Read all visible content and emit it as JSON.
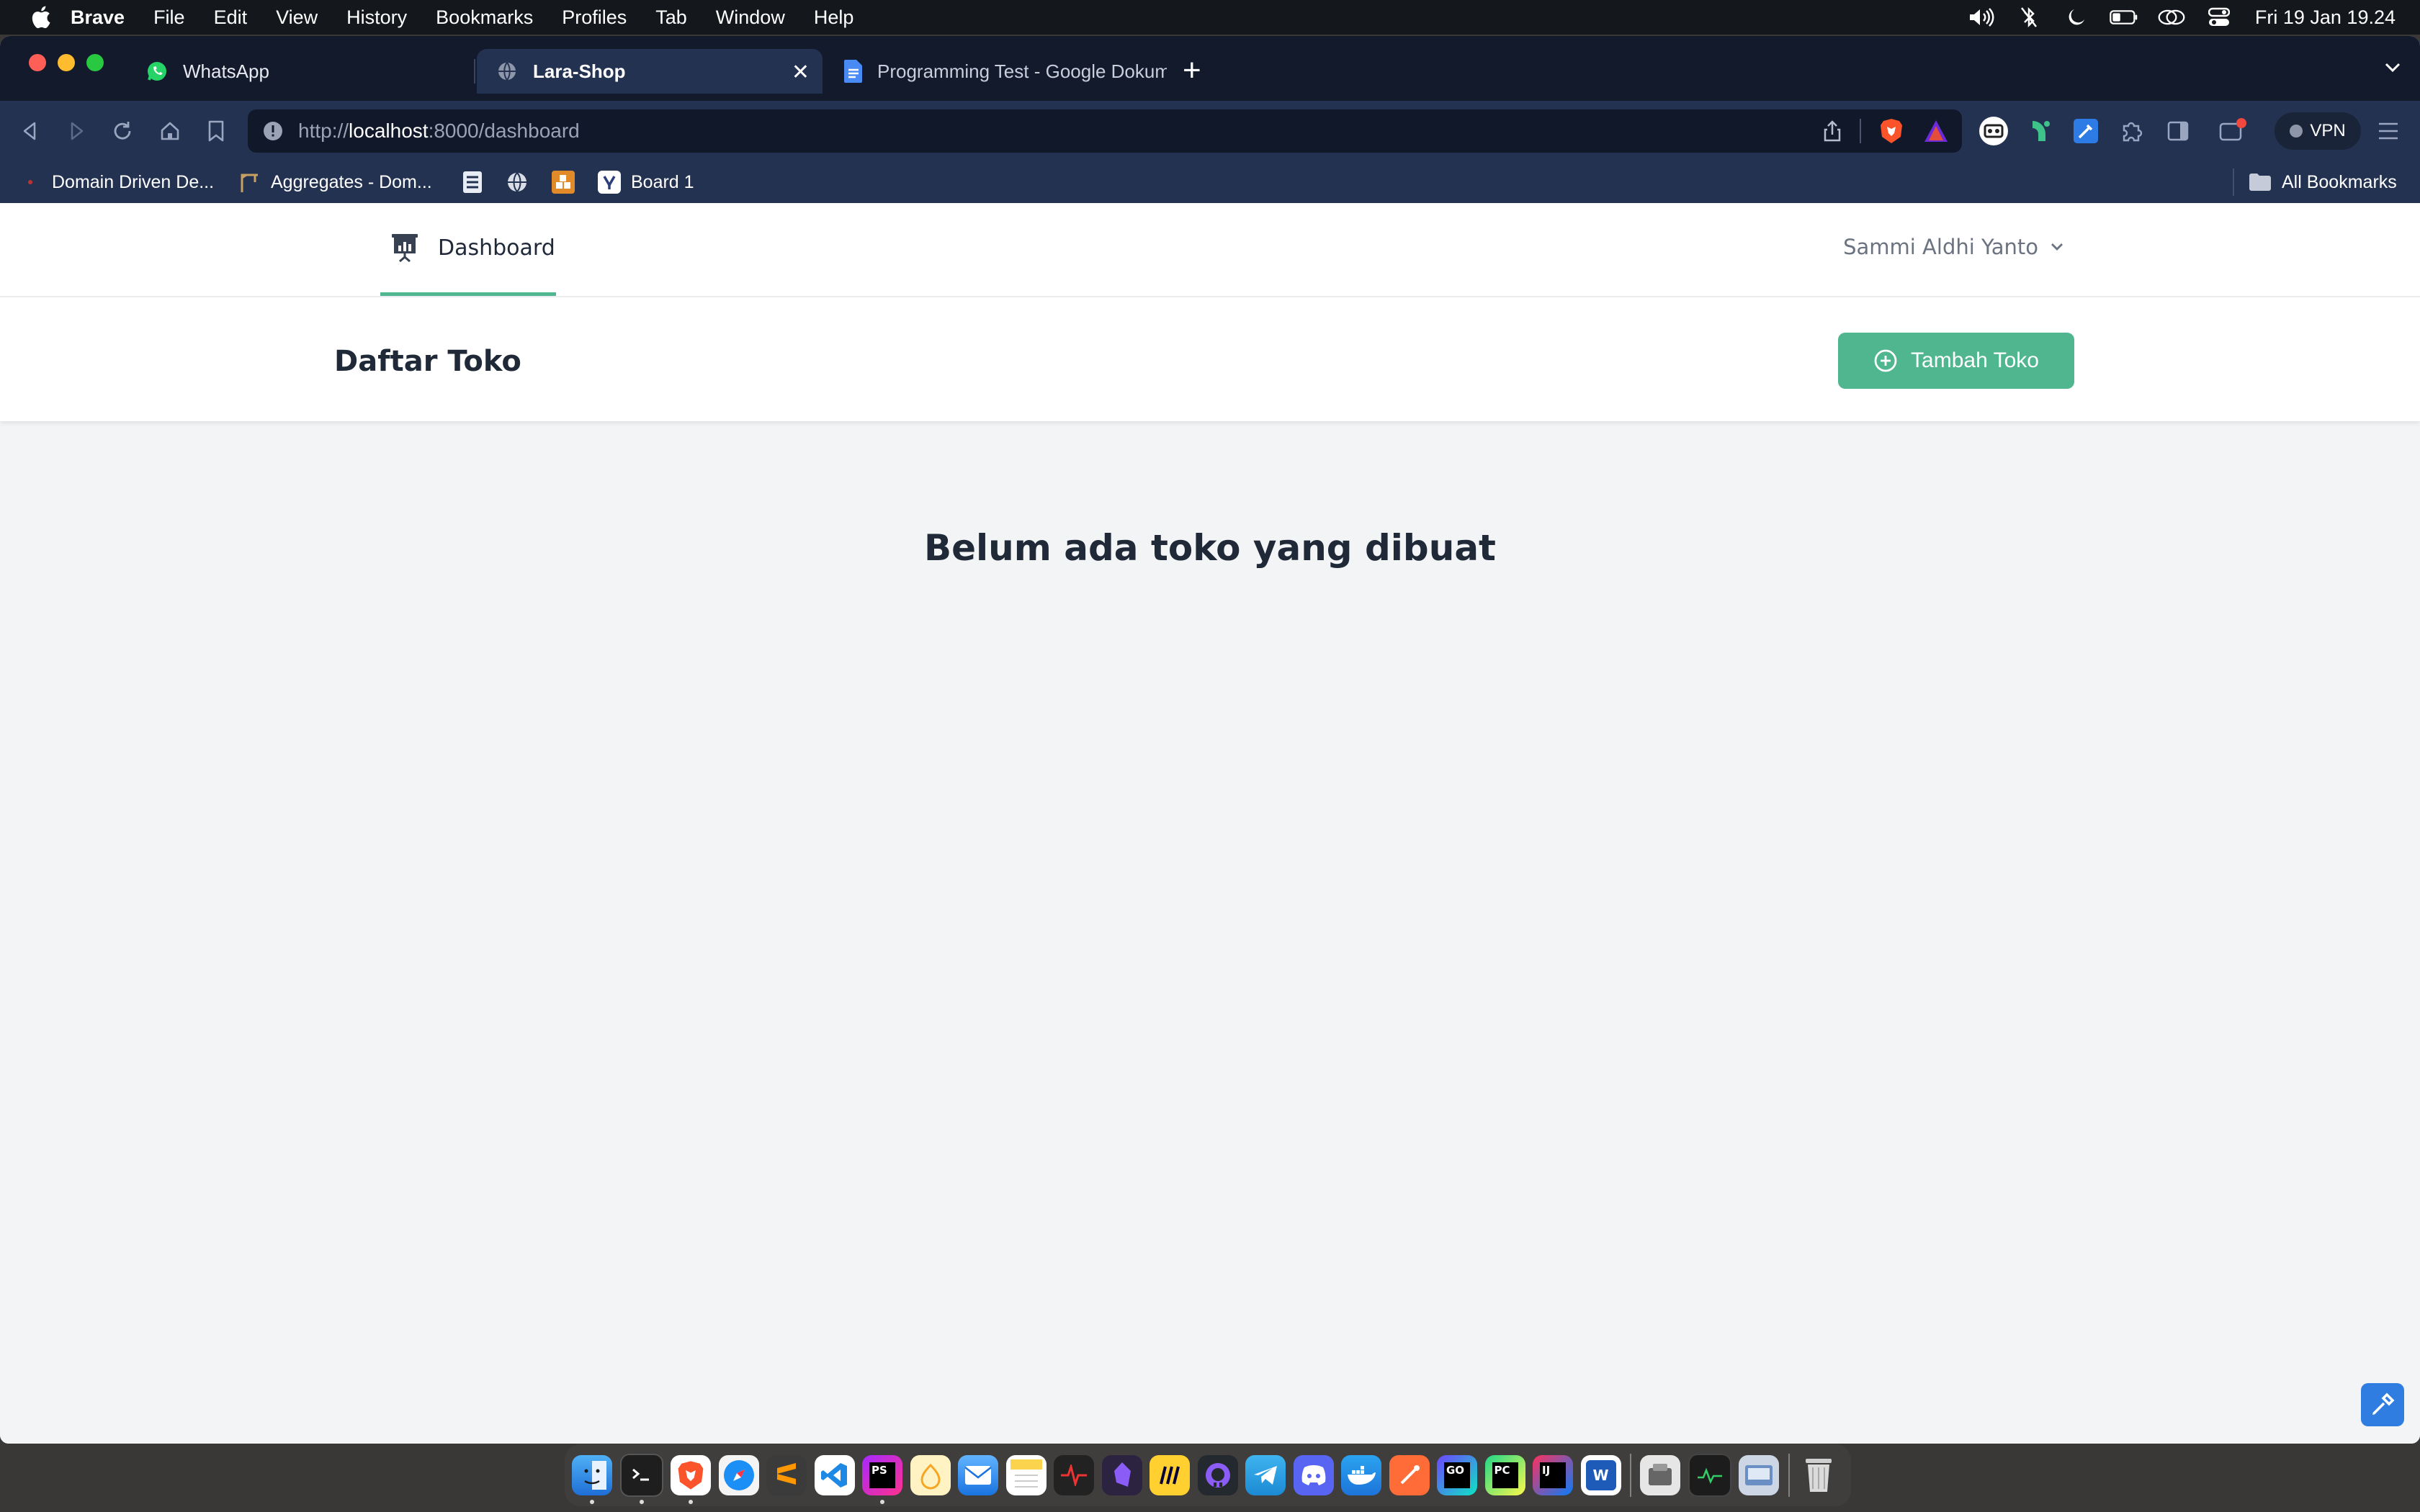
{
  "menubar": {
    "app_name": "Brave",
    "items": [
      "File",
      "Edit",
      "View",
      "History",
      "Bookmarks",
      "Profiles",
      "Tab",
      "Window",
      "Help"
    ],
    "clock": "Fri 19 Jan  19.24"
  },
  "tabs": [
    {
      "title": "WhatsApp",
      "icon": "whatsapp-icon"
    },
    {
      "title": "Lara-Shop",
      "icon": "globe-icon",
      "active": true
    },
    {
      "title": "Programming Test - Google Dokumen",
      "icon": "google-docs-icon"
    }
  ],
  "address": {
    "scheme": "http://",
    "host": "localhost",
    "rest": ":8000/dashboard"
  },
  "bookmarks": [
    {
      "label": "Domain Driven De...",
      "icon": "dot-icon"
    },
    {
      "label": "Aggregates - Dom...",
      "icon": "crane-icon"
    },
    {
      "label": "",
      "icon": "stack-icon"
    },
    {
      "label": "",
      "icon": "globe-icon"
    },
    {
      "label": "",
      "icon": "blocks-icon"
    },
    {
      "label": "Board 1",
      "icon": "board-icon"
    }
  ],
  "all_bookmarks": "All Bookmarks",
  "vpn_label": "VPN",
  "page": {
    "nav": {
      "dashboard": "Dashboard"
    },
    "user_name": "Sammi Aldhi Yanto",
    "title": "Daftar Toko",
    "add_button": "Tambah Toko",
    "empty_message": "Belum ada toko yang dibuat"
  },
  "colors": {
    "accent": "#4fb690",
    "browser_toolbar": "#243252",
    "tabbar": "#131a2c"
  },
  "dock": [
    "finder",
    "terminal",
    "brave",
    "safari",
    "sublime-text",
    "vscode",
    "phpstorm",
    "aloha",
    "mail",
    "notes",
    "activity",
    "obsidian",
    "miro",
    "github",
    "telegram",
    "discord",
    "docker",
    "postman",
    "goland",
    "pycharm",
    "intellij",
    "word",
    "preview",
    "activity-monitor",
    "screenshot",
    "trash"
  ]
}
